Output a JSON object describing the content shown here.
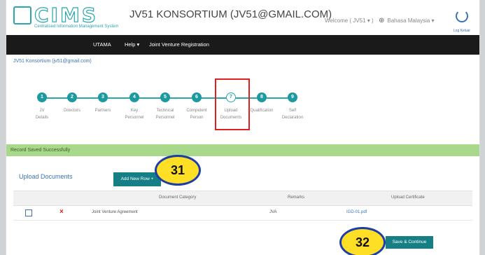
{
  "header": {
    "logo_text": "CIMS",
    "logo_subtitle": "Centralised Information Management System",
    "company_title": "JV51 KONSORTIUM (JV51@GMAIL.COM)",
    "welcome": "Welcome ( JV51 ▾ )",
    "language": "Bahasa Malaysia ▾",
    "logout": "Log Keluar"
  },
  "nav": {
    "items": [
      "UTAMA",
      "Help ▾",
      "Joint Venture Registration"
    ]
  },
  "company_line": "JV51 Konsortium (jv51@gmail.com)",
  "steps": [
    {
      "num": "1",
      "label": "JV\nDetails"
    },
    {
      "num": "2",
      "label": "Directors"
    },
    {
      "num": "3",
      "label": "Partners"
    },
    {
      "num": "4",
      "label": "Key\nPersonnel"
    },
    {
      "num": "5",
      "label": "Technical\nPersonnel"
    },
    {
      "num": "6",
      "label": "Competent\nPerson"
    },
    {
      "num": "7",
      "label": "Upload\nDocuments"
    },
    {
      "num": "8",
      "label": "Qualification"
    },
    {
      "num": "9",
      "label": "Self\nDeclaration"
    }
  ],
  "success_message": "Record Saved Successfully",
  "upload": {
    "title": "Upload Documents",
    "add_button": "Add New Row +",
    "columns": [
      "Document Category",
      "Remarks",
      "Upload Certificate"
    ],
    "rows": [
      {
        "category": "Joint Venture Agreement",
        "remarks": "JVA",
        "certificate": "IGD-01.pdf"
      }
    ],
    "save_button": "Save & Continue"
  },
  "callouts": [
    "31",
    "32"
  ]
}
